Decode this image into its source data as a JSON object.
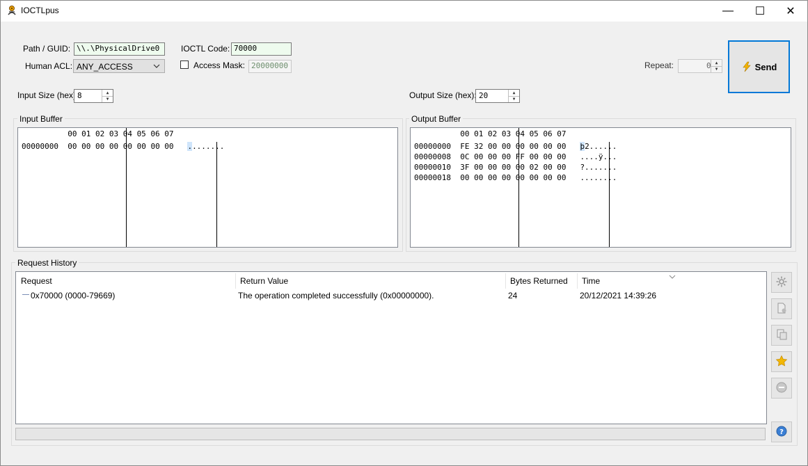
{
  "window": {
    "title": "IOCTLpus",
    "minimize": "—",
    "maximize": "☐",
    "close": "✕"
  },
  "request": {
    "path_label": "Path / GUID:",
    "path_value": "\\\\.\\PhysicalDrive0",
    "acl_label": "Human ACL:",
    "acl_value": "ANY_ACCESS",
    "ioctl_label": "IOCTL Code:",
    "ioctl_value": "70000",
    "access_mask_label": "Access Mask:",
    "access_mask_checked": false,
    "access_mask_value": "20000000",
    "repeat_label": "Repeat:",
    "repeat_value": "0",
    "send_label": "Send"
  },
  "input": {
    "size_label": "Input Size (hex):",
    "size_value": "8",
    "buffer_title": "Input Buffer",
    "header": "          00 01 02 03 04 05 06 07",
    "rows": [
      {
        "offset": "00000000",
        "hex": "00 00 00 00 00 00 00 00",
        "ascii_cursor": ".",
        "ascii": "......."
      }
    ]
  },
  "output": {
    "size_label": "Output Size (hex):",
    "size_value": "20",
    "buffer_title": "Output Buffer",
    "header": "          00 01 02 03 04 05 06 07",
    "rows": [
      {
        "offset": "00000000",
        "hex": "FE 32 00 00 00 00 00 00",
        "ascii_cursor": "þ",
        "ascii": "2......"
      },
      {
        "offset": "00000008",
        "hex": "0C 00 00 00 FF 00 00 00",
        "ascii_cursor": "",
        "ascii": "....ÿ..."
      },
      {
        "offset": "00000010",
        "hex": "3F 00 00 00 00 02 00 00",
        "ascii_cursor": "",
        "ascii": "?......."
      },
      {
        "offset": "00000018",
        "hex": "00 00 00 00 00 00 00 00",
        "ascii_cursor": "",
        "ascii": "........"
      }
    ]
  },
  "history": {
    "title": "Request History",
    "columns": [
      "Request",
      "Return Value",
      "Bytes Returned",
      "Time"
    ],
    "rows": [
      {
        "request": "0x70000 (0000-79669)",
        "return_value": "The operation completed successfully (0x00000000).",
        "bytes_returned": "24",
        "time": "20/12/2021 14:39:26"
      }
    ]
  },
  "side_buttons": [
    "gear-icon",
    "new-document-icon",
    "copy-document-icon",
    "star-icon",
    "remove-icon",
    "help-icon"
  ],
  "colors": {
    "send_border": "#0078d7",
    "send_icon": "#f4b400",
    "star": "#f2b705"
  }
}
